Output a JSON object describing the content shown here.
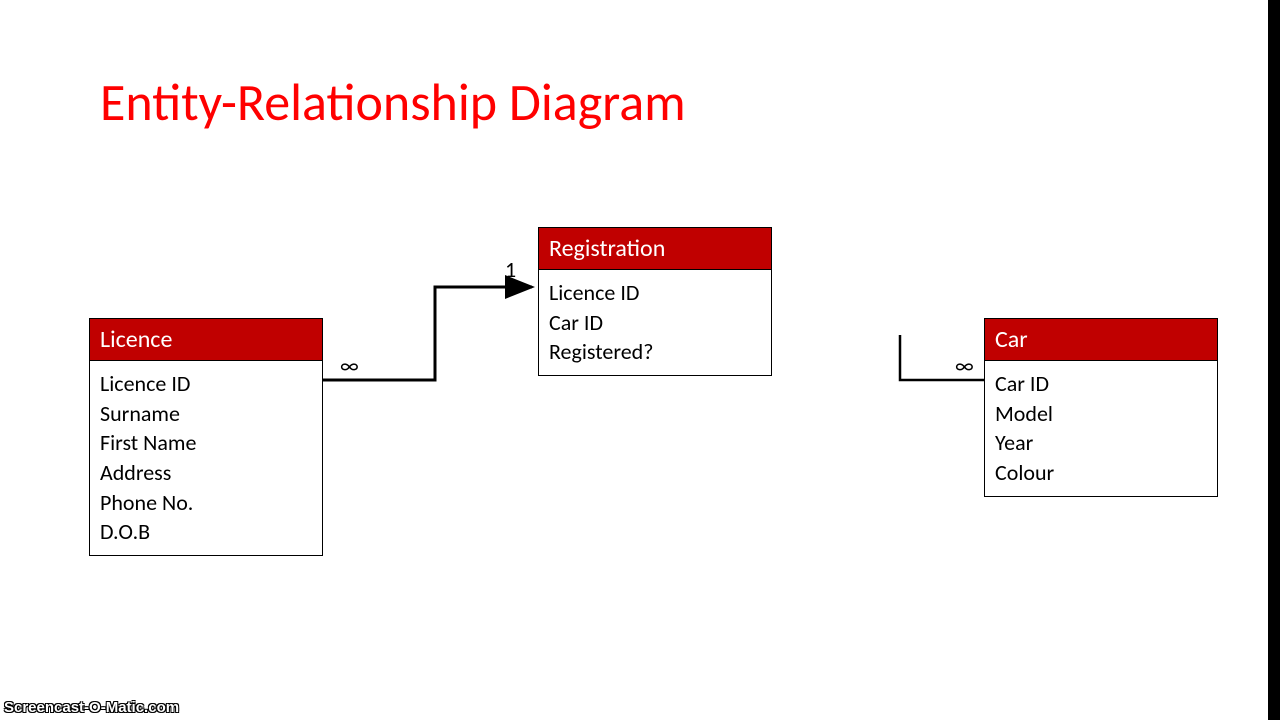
{
  "title": "Entity-Relationship Diagram",
  "entities": {
    "licence": {
      "name": "Licence",
      "attrs": [
        "Licence ID",
        "Surname",
        "First Name",
        "Address",
        "Phone No.",
        "D.O.B"
      ]
    },
    "registration": {
      "name": "Registration",
      "attrs": [
        "Licence ID",
        "Car ID",
        "Registered?"
      ]
    },
    "car": {
      "name": "Car",
      "attrs": [
        "Car ID",
        "Model",
        "Year",
        "Colour"
      ]
    }
  },
  "cardinality": {
    "licence_side": "∞",
    "registration_side": "1",
    "car_side": "∞"
  },
  "watermark": "Screencast-O-Matic.com"
}
